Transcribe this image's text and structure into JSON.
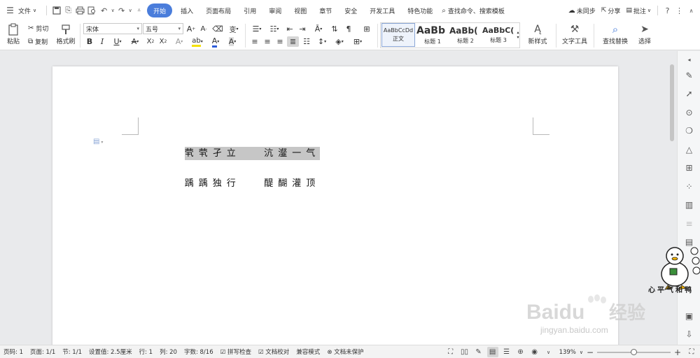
{
  "menubar": {
    "hamburger_icon": "menu-icon",
    "file_label": "文件",
    "tabs": [
      "开始",
      "插入",
      "页面布局",
      "引用",
      "审阅",
      "视图",
      "章节",
      "安全",
      "开发工具",
      "特色功能"
    ],
    "active_tab": "开始",
    "search_label": "查找命令、搜索模板",
    "sync_label": "未同步",
    "share_label": "分享",
    "comment_label": "批注"
  },
  "ribbon": {
    "paste_label": "粘贴",
    "cut_label": "剪切",
    "copy_label": "复制",
    "format_painter_label": "格式刷",
    "font_name": "宋体",
    "font_size": "五号",
    "styles": [
      {
        "sample": "AaBbCcDd",
        "name": "正文"
      },
      {
        "sample": "AaBb",
        "name": "标题 1"
      },
      {
        "sample": "AaBb(",
        "name": "标题 2"
      },
      {
        "sample": "AaBbC(",
        "name": "标题 3"
      }
    ],
    "new_style_label": "新样式",
    "text_tools_label": "文字工具",
    "find_replace_label": "查找替换",
    "select_label": "选择"
  },
  "document": {
    "line1_left": "茕茕孑立",
    "line1_right": "沆瀣一气",
    "line2_left": "踽踽独行",
    "line2_right": "醍醐灌顶"
  },
  "watermark": {
    "mascot_caption": "心平气和鸭",
    "baidu_brand": "Baidu",
    "baidu_cn": "经验",
    "baidu_url": "jingyan.baidu.com"
  },
  "statusbar": {
    "page_no": "页码: 1",
    "pages": "页面: 1/1",
    "section": "节: 1/1",
    "setting": "设置值: 2.5厘米",
    "row": "行: 1",
    "col": "列: 20",
    "words": "字数: 8/16",
    "spell_check": "拼写检查",
    "doc_proof": "文档校对",
    "compat_mode": "兼容模式",
    "doc_protect": "文档未保护",
    "zoom": "139%"
  },
  "colors": {
    "active_tab": "#4a7ddb",
    "selection": "#c6c6c6",
    "page": "#ffffff",
    "workspace": "#e9eaec"
  }
}
